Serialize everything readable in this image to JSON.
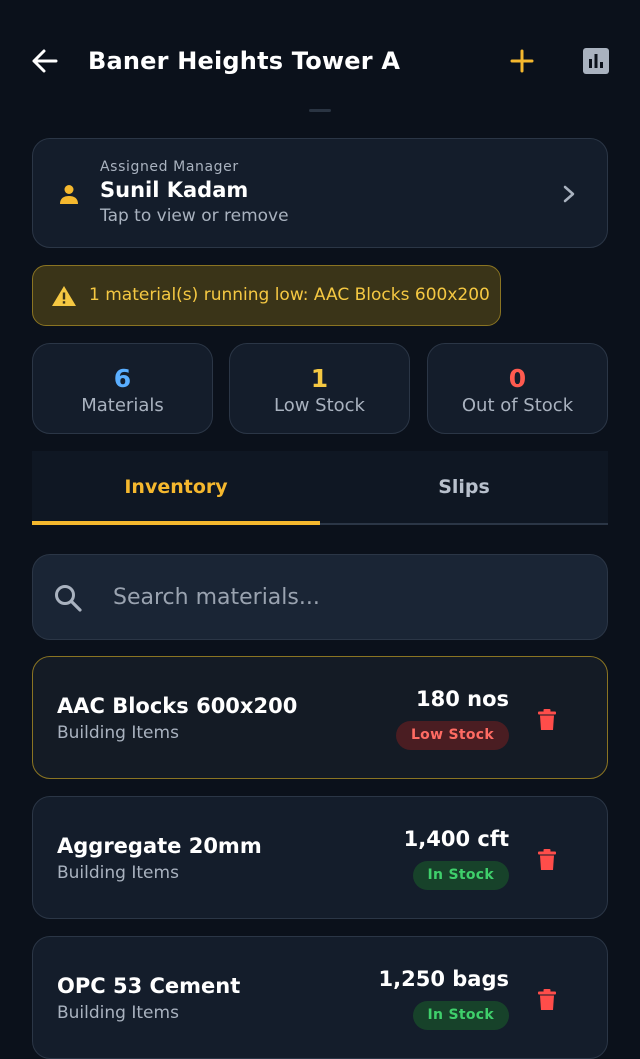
{
  "header": {
    "title": "Baner Heights Tower A",
    "icons": {
      "back": "arrow-left-icon",
      "add": "plus-icon",
      "report": "bar-chart-icon"
    },
    "accent_color": "#f5b82e"
  },
  "manager": {
    "label": "Assigned Manager",
    "name": "Sunil Kadam",
    "subtitle": "Tap to view or remove"
  },
  "alert": {
    "text": "1 material(s) running low: AAC Blocks 600x200",
    "color": "#f5c842"
  },
  "stats": [
    {
      "value": "6",
      "label": "Materials",
      "color": "#5aaeff"
    },
    {
      "value": "1",
      "label": "Low Stock",
      "color": "#f5c842"
    },
    {
      "value": "0",
      "label": "Out of Stock",
      "color": "#ff5a4f"
    }
  ],
  "tabs": [
    {
      "label": "Inventory",
      "active": true
    },
    {
      "label": "Slips",
      "active": false
    }
  ],
  "search": {
    "placeholder": "Search materials...",
    "value": ""
  },
  "materials": [
    {
      "name": "AAC Blocks 600x200",
      "category": "Building Items",
      "quantity": "180 nos",
      "status": "Low Stock"
    },
    {
      "name": "Aggregate 20mm",
      "category": "Building Items",
      "quantity": "1,400 cft",
      "status": "In Stock"
    },
    {
      "name": "OPC 53 Cement",
      "category": "Building Items",
      "quantity": "1,250 bags",
      "status": "In Stock"
    }
  ]
}
